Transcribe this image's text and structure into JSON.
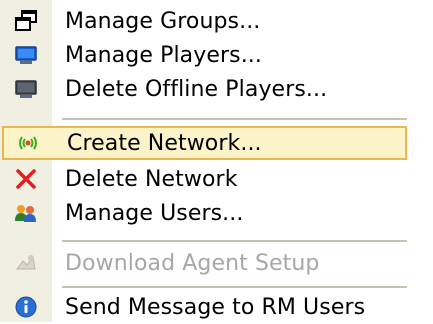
{
  "colors": {
    "gutter": "#f1efe2",
    "highlight_fill": "#fdf3c9",
    "highlight_border": "#e7b84e",
    "disabled_text": "#a7a6aa",
    "separator": "#c5c2b2"
  },
  "menu": {
    "items": [
      {
        "label": "Manage Groups...",
        "icon": "windows-group-icon",
        "enabled": true
      },
      {
        "label": "Manage Players...",
        "icon": "monitor-icon",
        "enabled": true
      },
      {
        "label": "Delete Offline Players...",
        "icon": "offline-monitor-icon",
        "enabled": true
      },
      {
        "label": "Create Network...",
        "icon": "network-antenna-icon",
        "enabled": true,
        "highlighted": true
      },
      {
        "label": "Delete Network",
        "icon": "red-x-icon",
        "enabled": true
      },
      {
        "label": "Manage Users...",
        "icon": "users-icon",
        "enabled": true
      },
      {
        "label": "Download Agent Setup",
        "icon": "setup-agent-icon",
        "enabled": false
      },
      {
        "label": "Send Message to RM Users",
        "icon": "info-icon",
        "enabled": true
      }
    ]
  }
}
